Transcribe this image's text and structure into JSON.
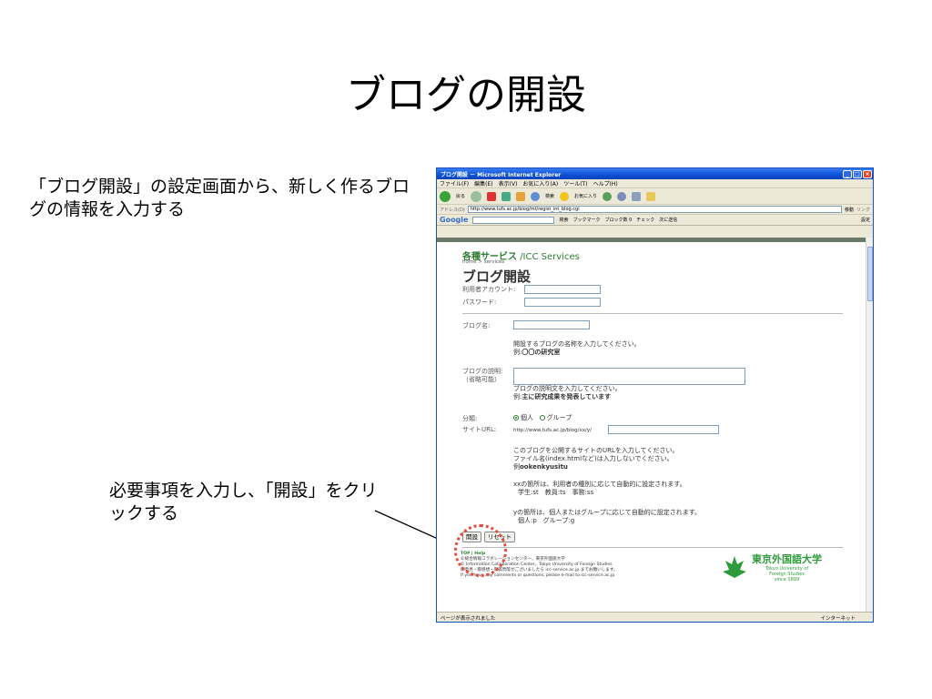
{
  "slide": {
    "title": "ブログの開設",
    "intro": "「ブログ開設」の設定画面から、新しく作るブログの情報を入力する",
    "note": "必要事項を入力し、「開設」をクリックする"
  },
  "browser": {
    "window_title": "ブログ開設 － Microsoft Internet Explorer",
    "menu": [
      "ファイル(F)",
      "編集(E)",
      "表示(V)",
      "お気に入り(A)",
      "ツール(T)",
      "ヘルプ(H)"
    ],
    "toolbar": {
      "back": "戻る",
      "search": "検索",
      "favorites": "お気に入り"
    },
    "address_label": "アドレス(D)",
    "address_url": "http://www.tufs.ac.jp/blog/mt/regist_int_blog.cgi",
    "go_label": "移動",
    "links_label": "リンク",
    "google": {
      "logo": "Google",
      "search": "検索",
      "bookmark": "ブックマーク",
      "blocked": "ブロック数 0",
      "check": "チェック",
      "send": "次に送信",
      "settings": "設定"
    },
    "status": "ページが表示されました",
    "zone": "インターネット"
  },
  "page": {
    "services": "各種サービス",
    "services_en": "/ICC Services",
    "breadcrumb": "home > services",
    "title": "ブログ開設",
    "account_label": "利用者アカウント:",
    "password_label": "パスワード:",
    "blogname_label": "ブログ名:",
    "blogname_hint1": "開設するブログの名称を入力してください。",
    "blogname_hint2_prefix": "例:",
    "blogname_hint2_bold": "〇〇の研究室",
    "desc_label1": "ブログの説明:",
    "desc_label2": "（省略可能）",
    "desc_hint1": "ブログの説明文を入力してください。",
    "desc_hint2_prefix": "例:",
    "desc_hint2_bold": "主に研究成果を発表しています",
    "class_label": "分類:",
    "class_personal": "個人",
    "class_group": "グループ",
    "siteurl_label": "サイトURL:",
    "siteurl_prefix": "http://www.tufs.ac.jp/blog/xx/y/",
    "url_hint1": "このブログを公開するサイトのURLを入力してください。",
    "url_hint2": "ファイル名(index.htmlなど)は入力しないでください。",
    "url_hint3_prefix": "例",
    "url_hint3_bold": "ookenkyusitu",
    "xx_hint1": "xxの箇所は、利用者の種別に応じて自動的に設定されます。",
    "xx_hint2": "学生:st　教員:ts　事務:ss",
    "y_hint1": "yの箇所は、個人またはグループに応じて自動的に設定されます。",
    "y_hint2": "個人:p　グループ:g",
    "submit": "開設",
    "reset": "リセット",
    "footer": [
      "TOP | Help",
      "©総合情報コラボレーションセンター，東京外国語大学",
      "© Information Collaboration Center，Tokyo University of Foreign Studies",
      "御意見・御感想・御質問等がございましたら icc-service.ac.jp までお願いします。",
      "If you have any comments or questions, please e-mail to icc-service.ac.jp"
    ],
    "univ_name": "東京外国語大学",
    "univ_en1": "Tokyo University of",
    "univ_en2": "Foreign Studies",
    "univ_since": "since 1899"
  },
  "colors": {
    "accent_green": "#2e7d32",
    "xp_blue": "#0b51d6",
    "circle_red": "#e64b3c"
  }
}
